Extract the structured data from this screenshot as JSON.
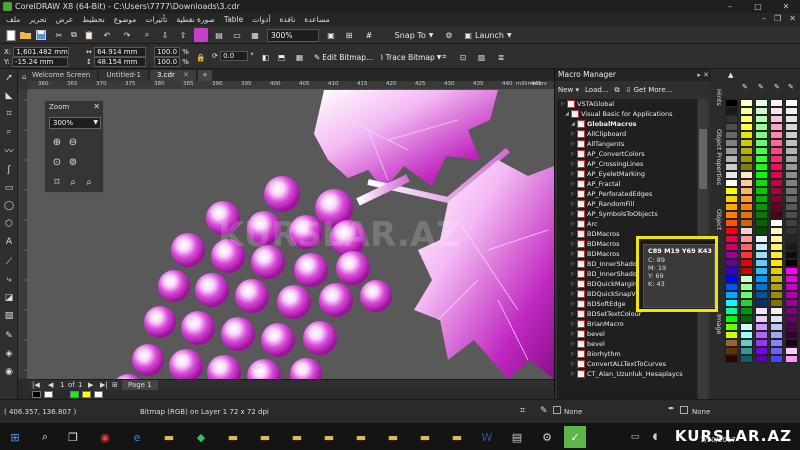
{
  "window": {
    "title": "CorelDRAW X8 (64-Bit) - C:\\Users\\7777\\Downloads\\3.cdr",
    "controls": [
      "–",
      "□",
      "✕"
    ]
  },
  "menu": {
    "items": [
      "ملف",
      "تحرير",
      "عرض",
      "تخطيط",
      "موضوع",
      "تأثيرات",
      "صورة نقطية",
      "Table",
      "أدوات",
      "نافذة",
      "مساعدة"
    ]
  },
  "toolbar": {
    "zoom_level": "300%",
    "snap_to": "Snap To",
    "launch": "Launch"
  },
  "property_bar": {
    "x": "1,601.482 mm",
    "y": "-15.24 mm",
    "width": "64.914 mm",
    "height": "48.154 mm",
    "scale_x": "100.0",
    "scale_y": "100.0",
    "scale_unit": "%",
    "rotation": "0.0",
    "edit_bitmap": "Edit Bitmap...",
    "trace_bitmap": "Trace Bitmap"
  },
  "tabs": {
    "welcome": "Welcome Screen",
    "untitled": "Untitled-1",
    "current": "3.cdr",
    "add": "+"
  },
  "ruler": {
    "ticks": [
      "360",
      "365",
      "370",
      "375",
      "380",
      "385",
      "390",
      "395",
      "400",
      "405",
      "410",
      "415",
      "420",
      "425",
      "430",
      "435",
      "440",
      "445"
    ],
    "unit": "millimeters"
  },
  "zoom_docker": {
    "title": "Zoom",
    "close": "✕",
    "value": "300%"
  },
  "canvas": {
    "watermark": "KURSLAR.AZ"
  },
  "page_nav": {
    "position": "1",
    "of_label": "of",
    "total": "1",
    "page_tab": "Page 1"
  },
  "status": {
    "coordinates": "( 406.357, 136.807 )",
    "object_info": "Bitmap (RGB) on Layer 1 72 x 72 dpi",
    "fill_none": "None",
    "outline_none": "None"
  },
  "macro_manager": {
    "title": "Macro Manager",
    "new_label": "New",
    "load_label": "Load...",
    "get_more": "Get More...",
    "items": [
      "VSTAGlobal",
      "Visual Basic for Applications",
      "GlobalMacros",
      "AllClipboard",
      "AllTangents",
      "AP_ConvertColors",
      "AP_CrossingLines",
      "AP_EyeletMarking",
      "AP_Fractal",
      "AP_PerforatedEdges",
      "AP_RandomFill",
      "AP_SymbolsToObjects",
      "Arc",
      "BDMacros",
      "BDMacros",
      "BDMacros",
      "BD_InnerShadow",
      "BD_InnerShadow",
      "BDQuickMarginsPTB",
      "BDQuickSnapView",
      "BDSoftEdge",
      "BDSetTextColour",
      "BrianMacro",
      "bevel",
      "bevel",
      "Biorhythm",
      "ConvertALLTextToCurves",
      "CT_Alan_Uzunluk_Hesaplaycs"
    ]
  },
  "docker_tabs": [
    "Hints",
    "Object Properties",
    "Object",
    "Image"
  ],
  "color_tooltip": {
    "title": "C89 M19 Y69 K43",
    "c": "C: 89",
    "m": "M: 19",
    "y": "Y: 69",
    "k": "K: 43"
  },
  "palette_colors": {
    "col1": [
      "#000000",
      "#1a1a1a",
      "#333333",
      "#4d4d4d",
      "#666666",
      "#808080",
      "#999999",
      "#b3b3b3",
      "#cccccc",
      "#e6e6e6",
      "#ffffff",
      "#ffff00",
      "#ffd400",
      "#ffaa00",
      "#ff7f00",
      "#ff5500",
      "#ff0000",
      "#e6004d",
      "#cc0066",
      "#990099",
      "#660099",
      "#3300cc",
      "#0000ff",
      "#0055ff",
      "#00aaff",
      "#00ffff",
      "#00ff99",
      "#00ff00",
      "#66ff00",
      "#ccff00",
      "#996633",
      "#663300",
      "#330000"
    ],
    "col2": [
      "#ffffcc",
      "#ffff99",
      "#ffff66",
      "#ffff33",
      "#e6e600",
      "#cccc00",
      "#b3b300",
      "#999900",
      "#808000",
      "#ffe6cc",
      "#ffcc99",
      "#ffb366",
      "#ff9933",
      "#ff8000",
      "#e67300",
      "#cc6600",
      "#ffcccc",
      "#ff9999",
      "#ff6666",
      "#ff3333",
      "#e60000",
      "#cc0000",
      "#ccffcc",
      "#99ff99",
      "#66ff66",
      "#33cc33",
      "#009900",
      "#006600",
      "#ccffff",
      "#99ffff",
      "#66cccc",
      "#339999",
      "#006666"
    ],
    "col3": [
      "#e6ffe6",
      "#ccffcc",
      "#b3ffb3",
      "#99ff99",
      "#80ff80",
      "#66ff66",
      "#4dff4d",
      "#33ff33",
      "#1aff1a",
      "#00ff00",
      "#00e600",
      "#00cc00",
      "#00b300",
      "#009900",
      "#008000",
      "#006600",
      "#004d00",
      "#e6f7ff",
      "#cceeff",
      "#99ddff",
      "#66ccff",
      "#33bbff",
      "#0099ff",
      "#0077cc",
      "#005599",
      "#003366",
      "#f2e6ff",
      "#e6ccff",
      "#cc99ff",
      "#b366ff",
      "#9933ff",
      "#7a00e6",
      "#5c00b3"
    ],
    "col4": [
      "#fff0f5",
      "#ffe0eb",
      "#ffc2d6",
      "#ffa3c2",
      "#ff85ad",
      "#ff6699",
      "#ff4785",
      "#ff2970",
      "#ff0a5c",
      "#e6004d",
      "#c70042",
      "#a80038",
      "#8a002e",
      "#6b0024",
      "#4d001a",
      "#fffde6",
      "#fffacc",
      "#fff599",
      "#fff066",
      "#ffeb33",
      "#ffe600",
      "#e6cf00",
      "#ccb800",
      "#b3a100",
      "#998a00",
      "#807300",
      "#f0f0ff",
      "#e0e0ff",
      "#c2c2ff",
      "#a3a3ff",
      "#8585ff",
      "#6666ff",
      "#4747ff"
    ],
    "col5": [
      "#ffffff",
      "#f2f2f2",
      "#e6e6e6",
      "#d9d9d9",
      "#cccccc",
      "#bfbfbf",
      "#b3b3b3",
      "#a6a6a6",
      "#999999",
      "#8c8c8c",
      "#808080",
      "#737373",
      "#666666",
      "#595959",
      "#4d4d4d",
      "#404040",
      "#333333",
      "#262626",
      "#1a1a1a",
      "#0d0d0d",
      "#000000",
      "#ff00ff",
      "#e600e6",
      "#cc00cc",
      "#b300b3",
      "#990099",
      "#800080",
      "#660066",
      "#4d004d",
      "#330033",
      "#1a001a",
      "#ffccff",
      "#ff99ff"
    ]
  },
  "swatches": [
    "#000000",
    "#ffffff",
    "#00ff00",
    "#ffff00",
    "#ffffff"
  ],
  "taskbar": {
    "watermark": "KURSLAR.AZ",
    "date": "1/20/2017"
  }
}
